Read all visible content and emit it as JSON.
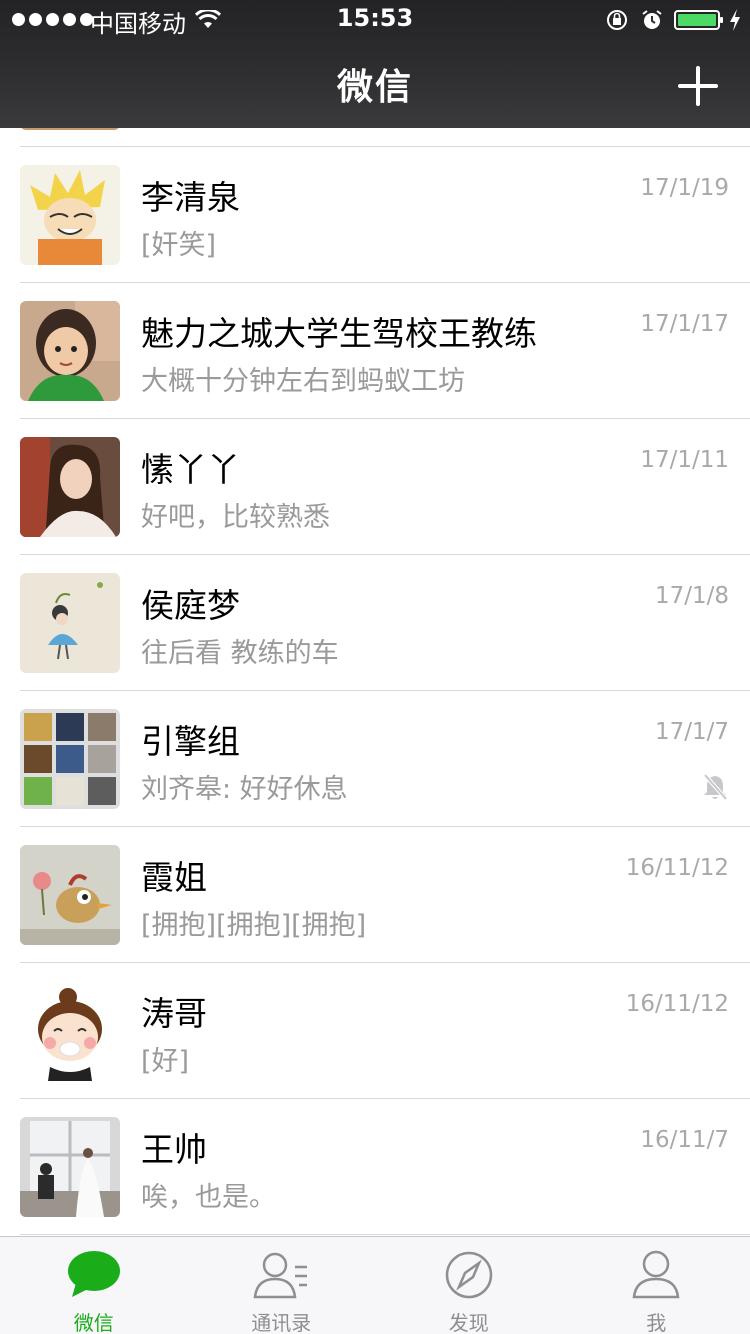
{
  "status_bar": {
    "carrier": "中国移动",
    "time": "15:53"
  },
  "nav": {
    "title": "微信"
  },
  "chats": [
    {
      "name": "李清泉",
      "preview": "[奸笑]",
      "time": "17/1/19",
      "muted": false
    },
    {
      "name": "魅力之城大学生驾校王教练",
      "preview": "大概十分钟左右到蚂蚁工坊",
      "time": "17/1/17",
      "muted": false
    },
    {
      "name": "愫丫丫",
      "preview": "好吧，比较熟悉",
      "time": "17/1/11",
      "muted": false
    },
    {
      "name": "侯庭梦",
      "preview": "往后看 教练的车",
      "time": "17/1/8",
      "muted": false
    },
    {
      "name": "引擎组",
      "preview": "刘齐皋: 好好休息",
      "time": "17/1/7",
      "muted": true
    },
    {
      "name": "霞姐",
      "preview": "[拥抱][拥抱][拥抱]",
      "time": "16/11/12",
      "muted": false
    },
    {
      "name": "涛哥",
      "preview": "[好]",
      "time": "16/11/12",
      "muted": false
    },
    {
      "name": "王帅",
      "preview": "唉，也是。",
      "time": "16/11/7",
      "muted": false
    }
  ],
  "tabs": [
    {
      "label": "微信",
      "icon": "chat-bubble-icon",
      "active": true
    },
    {
      "label": "通讯录",
      "icon": "contacts-icon",
      "active": false
    },
    {
      "label": "发现",
      "icon": "compass-icon",
      "active": false
    },
    {
      "label": "我",
      "icon": "person-icon",
      "active": false
    }
  ],
  "colors": {
    "accent": "#1aad19",
    "nav_bg": "#2f2f31",
    "secondary_text": "#9a9a9a"
  }
}
